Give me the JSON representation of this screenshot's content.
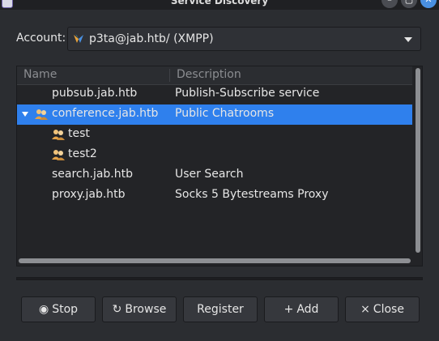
{
  "window": {
    "title": "Service Discovery",
    "controls": {
      "minimize": "–",
      "maximize": "▢",
      "close": "✕"
    }
  },
  "account": {
    "label": "Account:",
    "value": "p3ta@jab.htb/ (XMPP)"
  },
  "tree": {
    "columns": {
      "name": "Name",
      "description": "Description"
    },
    "rows": [
      {
        "name": "pubsub.jab.htb",
        "description": "Publish-Subscribe service"
      },
      {
        "name": "conference.jab.htb",
        "description": "Public Chatrooms"
      },
      {
        "name": "test",
        "description": ""
      },
      {
        "name": "test2",
        "description": ""
      },
      {
        "name": "search.jab.htb",
        "description": "User Search"
      },
      {
        "name": "proxy.jab.htb",
        "description": "Socks 5 Bytestreams Proxy"
      }
    ]
  },
  "buttons": {
    "stop": {
      "label": "Stop",
      "icon": "◉"
    },
    "browse": {
      "label": "Browse",
      "icon": "↻"
    },
    "register": {
      "label": "Register"
    },
    "add": {
      "label": "Add",
      "icon": "+"
    },
    "close": {
      "label": "Close",
      "icon": "×"
    }
  },
  "colors": {
    "selection": "#2f80ed",
    "background": "#2b2d31"
  }
}
